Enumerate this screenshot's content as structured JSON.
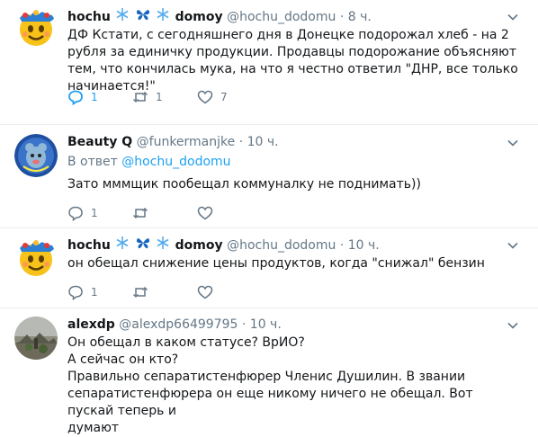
{
  "tweets": [
    {
      "name": "hochu",
      "name2": "domoy",
      "handle": "@hochu_dodomu",
      "dot": "·",
      "time": "8 ч.",
      "text": "ДФ Кстати, с сегодняшнего дня в Донецке подорожал хлеб - на 2 рубля за единичку продукции. Продавцы подорожание объясняют тем, что кончилась мука, на что я честно ответил \"ДНР, все только начинается!\"",
      "replies": "1",
      "retweets": "1",
      "likes": "7"
    },
    {
      "name": "Beauty Q",
      "handle": "@funkermanjke",
      "dot": "·",
      "time": "10 ч.",
      "reply_prefix": "В ответ",
      "reply_handle": "@hochu_dodomu",
      "text": "Зато мммщик пообещал коммуналку не поднимать))",
      "replies": "1",
      "retweets": "",
      "likes": ""
    },
    {
      "name": "hochu",
      "name2": "domoy",
      "handle": "@hochu_dodomu",
      "dot": "·",
      "time": "10 ч.",
      "text": "он обещал снижение цены продуктов, когда \"снижал\" бензин",
      "replies": "1",
      "retweets": "",
      "likes": ""
    },
    {
      "name": "alexdp",
      "handle": "@alexdp66499795",
      "dot": "·",
      "time": "10 ч.",
      "lines": [
        "Он обещал в каком статусе? ВрИО?",
        "А сейчас он кто?",
        "Правильно сепаратистенфюрер Членис Душилин. В звании",
        "сепаратистенфюрера он еще никому ничего не обещал. Вот пускай теперь и",
        "думают"
      ]
    }
  ],
  "icons": {
    "reply": "reply-icon",
    "retweet": "retweet-icon",
    "like": "heart-icon",
    "more": "chevron-down-icon",
    "snowflake": "snowflake-icon",
    "butterfly": "butterfly-icon"
  },
  "colors": {
    "accent": "#1da1f2",
    "secondary_text": "#657786",
    "separator": "#e6ecf0"
  }
}
